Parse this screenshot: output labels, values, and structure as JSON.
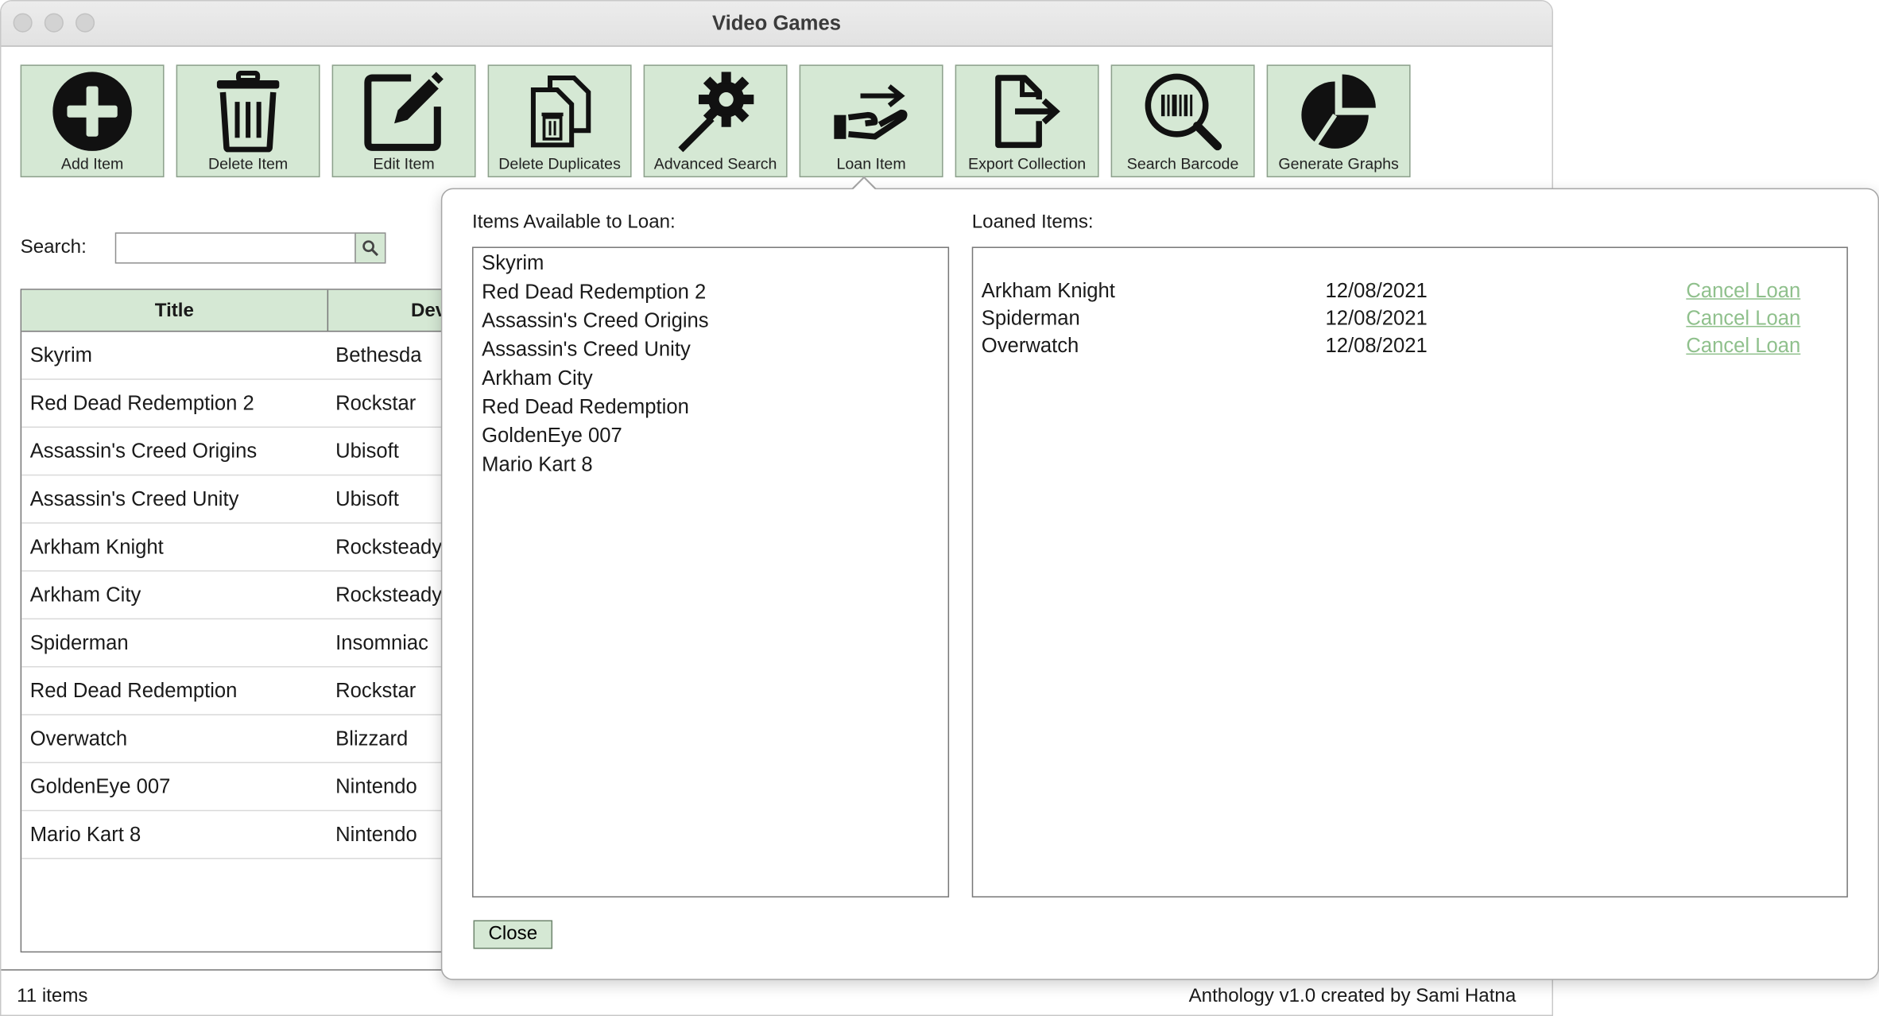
{
  "window": {
    "title": "Video Games"
  },
  "toolbar": [
    {
      "label": "Add Item",
      "icon": "add-circle-icon"
    },
    {
      "label": "Delete Item",
      "icon": "trash-icon"
    },
    {
      "label": "Edit Item",
      "icon": "edit-icon"
    },
    {
      "label": "Delete Duplicates",
      "icon": "duplicate-delete-icon"
    },
    {
      "label": "Advanced Search",
      "icon": "magic-wand-gear-icon"
    },
    {
      "label": "Loan Item",
      "icon": "hand-loan-icon"
    },
    {
      "label": "Export Collection",
      "icon": "file-export-icon"
    },
    {
      "label": "Search Barcode",
      "icon": "barcode-search-icon"
    },
    {
      "label": "Generate Graphs",
      "icon": "pie-chart-icon"
    }
  ],
  "search": {
    "label": "Search:",
    "value": "",
    "button_icon": "magnifier-icon"
  },
  "table": {
    "headers": [
      "Title",
      "Develop"
    ],
    "rows": [
      [
        "Skyrim",
        "Bethesda"
      ],
      [
        "Red Dead Redemption 2",
        "Rockstar"
      ],
      [
        "Assassin's Creed Origins",
        "Ubisoft"
      ],
      [
        "Assassin's Creed Unity",
        "Ubisoft"
      ],
      [
        "Arkham Knight",
        "Rocksteady"
      ],
      [
        "Arkham City",
        "Rocksteady"
      ],
      [
        "Spiderman",
        "Insomniac"
      ],
      [
        "Red Dead Redemption",
        "Rockstar"
      ],
      [
        "Overwatch",
        "Blizzard"
      ],
      [
        "GoldenEye 007",
        "Nintendo"
      ],
      [
        "Mario Kart 8",
        "Nintendo"
      ]
    ]
  },
  "status": {
    "count": "11 items",
    "credit": "Anthology v1.0 created by Sami Hatna"
  },
  "loan_popover": {
    "available_label": "Items Available to Loan:",
    "loaned_label": "Loaned Items:",
    "available": [
      "Skyrim",
      "Red Dead Redemption 2",
      "Assassin's Creed Origins",
      "Assassin's Creed Unity",
      "Arkham City",
      "Red Dead Redemption",
      "GoldenEye 007",
      "Mario Kart 8"
    ],
    "loaned": [
      {
        "title": "Arkham Knight",
        "date": "12/08/2021",
        "action": "Cancel Loan"
      },
      {
        "title": "Spiderman",
        "date": "12/08/2021",
        "action": "Cancel Loan"
      },
      {
        "title": "Overwatch",
        "date": "12/08/2021",
        "action": "Cancel Loan"
      }
    ],
    "close_label": "Close"
  },
  "colors": {
    "accent_green": "#d5e8d4",
    "link_green": "#8fc08c"
  }
}
